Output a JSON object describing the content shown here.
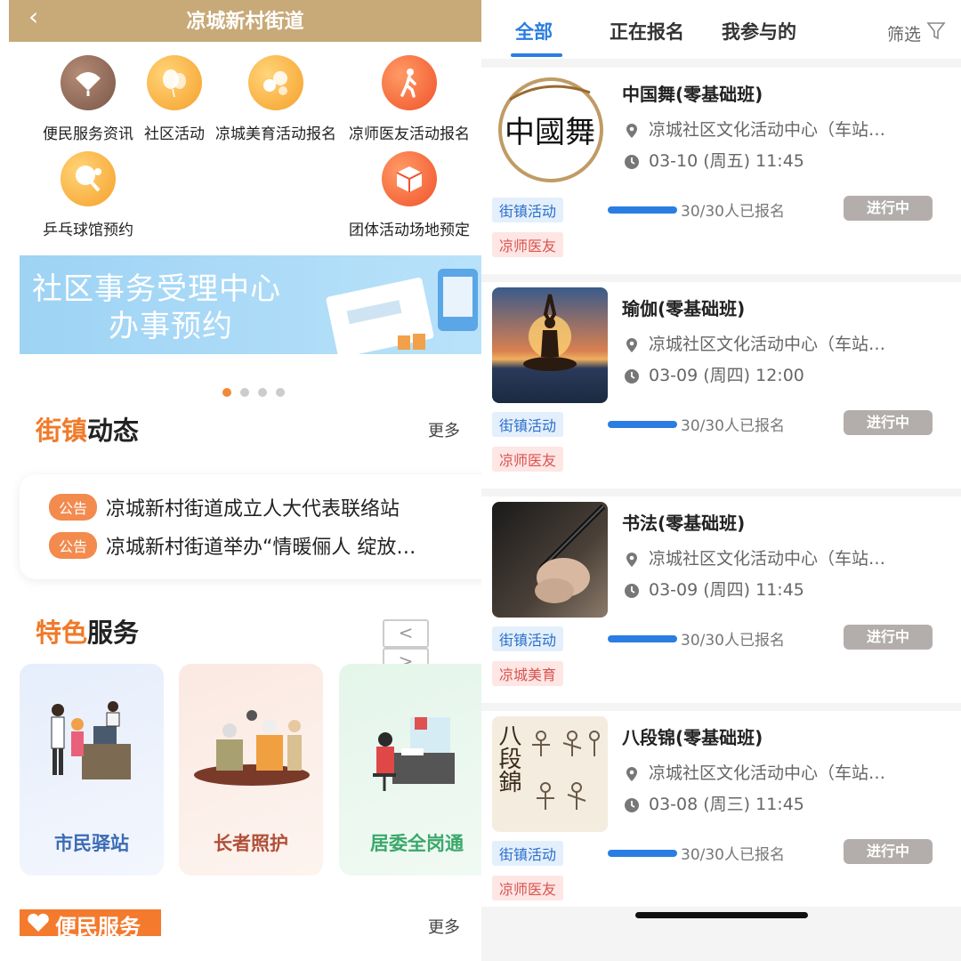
{
  "left": {
    "header": {
      "back_icon": "‹",
      "title": "凉城新村街道"
    },
    "grid": [
      {
        "label": "便民服务资讯",
        "icon": "fan-icon"
      },
      {
        "label": "社区活动",
        "icon": "balloon-icon"
      },
      {
        "label": "凉城美育活动报名",
        "icon": "circles-icon"
      },
      {
        "label": "凉师医友活动报名",
        "icon": "walker-icon"
      },
      {
        "label": "乒乓球馆预约",
        "icon": "pingpong-icon"
      },
      {
        "label": "团体活动场地预定",
        "icon": "box-icon"
      }
    ],
    "banner": {
      "line1": "社区事务受理中心",
      "line2": "办事预约",
      "active_dot": 0,
      "dot_count": 4
    },
    "news_section": {
      "title_accent": "街镇",
      "title_rest": "动态",
      "more": "更多"
    },
    "news": [
      {
        "badge": "公告",
        "text": "凉城新村街道成立人大代表联络站"
      },
      {
        "badge": "公告",
        "text": "凉城新村街道举办“情暖俪人 绽放…"
      }
    ],
    "feature_section": {
      "title_accent": "特色",
      "title_rest": "服务",
      "prev": "<",
      "next": ">"
    },
    "feature_cards": [
      {
        "label": "市民驿站",
        "color": "#3a6bb5"
      },
      {
        "label": "长者照护",
        "color": "#b0503a"
      },
      {
        "label": "居委全岗通",
        "color": "#3aa86a"
      }
    ],
    "bottom": {
      "title": "便民服务",
      "more": "更多"
    }
  },
  "right": {
    "tabs": [
      {
        "label": "全部",
        "active": true
      },
      {
        "label": "正在报名",
        "active": false
      },
      {
        "label": "我参与的",
        "active": false
      }
    ],
    "filter": "筛选",
    "activities": [
      {
        "title": "中国舞(零基础班)",
        "location": "凉城社区文化活动中心（车站…",
        "time": "03-10 (周五) 11:45",
        "tag1": "街镇活动",
        "tag2": "凉师医友",
        "registered": "30/30人已报名",
        "status": "进行中",
        "progress": 1.0,
        "thumb_text": "中國舞"
      },
      {
        "title": "瑜伽(零基础班)",
        "location": "凉城社区文化活动中心（车站…",
        "time": "03-09 (周四) 12:00",
        "tag1": "街镇活动",
        "tag2": "凉师医友",
        "registered": "30/30人已报名",
        "status": "进行中",
        "progress": 1.0,
        "thumb_text": ""
      },
      {
        "title": "书法(零基础班)",
        "location": "凉城社区文化活动中心（车站…",
        "time": "03-09 (周四) 11:45",
        "tag1": "街镇活动",
        "tag2": "凉城美育",
        "registered": "30/30人已报名",
        "status": "进行中",
        "progress": 1.0,
        "thumb_text": ""
      },
      {
        "title": "八段锦(零基础班)",
        "location": "凉城社区文化活动中心（车站…",
        "time": "03-08 (周三) 11:45",
        "tag1": "街镇活动",
        "tag2": "凉师医友",
        "registered": "30/30人已报名",
        "status": "进行中",
        "progress": 1.0,
        "thumb_text": "八段錦"
      }
    ]
  }
}
